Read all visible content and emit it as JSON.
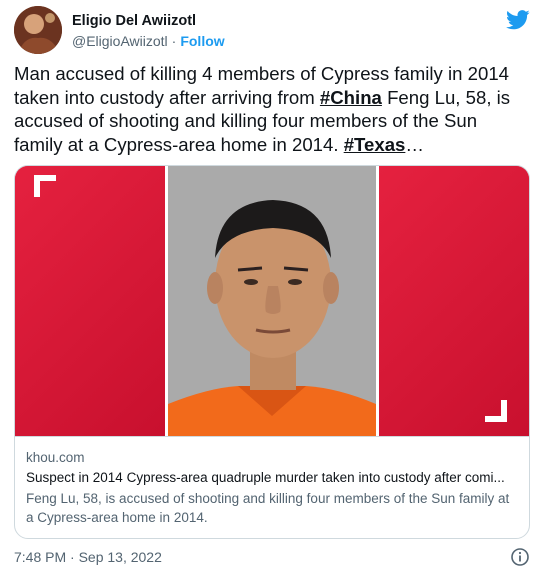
{
  "author": {
    "display_name": "Eligio Del Awiizotl",
    "handle": "@EligioAwiizotl",
    "separator": "·",
    "follow_label": "Follow"
  },
  "tweet": {
    "text_part1": "Man accused of killing 4 members of Cypress family in 2014 taken into custody after arriving from ",
    "hashtag1": "#China",
    "text_part2": " Feng Lu, 58, is accused of shooting and killing four members of the Sun family at a Cypress-area home in 2014. ",
    "hashtag2": "#Texas",
    "ellipsis": "…"
  },
  "card": {
    "domain": "khou.com",
    "title": "Suspect in 2014 Cypress-area quadruple murder taken into custody after comi...",
    "description": "Feng Lu, 58, is accused of shooting and killing four members of the Sun family at a Cypress-area home in 2014."
  },
  "footer": {
    "timestamp": "7:48 PM · Sep 13, 2022"
  },
  "colors": {
    "twitter_blue": "#1d9bf0",
    "card_red": "#e01e3c",
    "jumpsuit_orange": "#f26a1b"
  },
  "icons": [
    "twitter-bird-icon",
    "info-icon"
  ]
}
